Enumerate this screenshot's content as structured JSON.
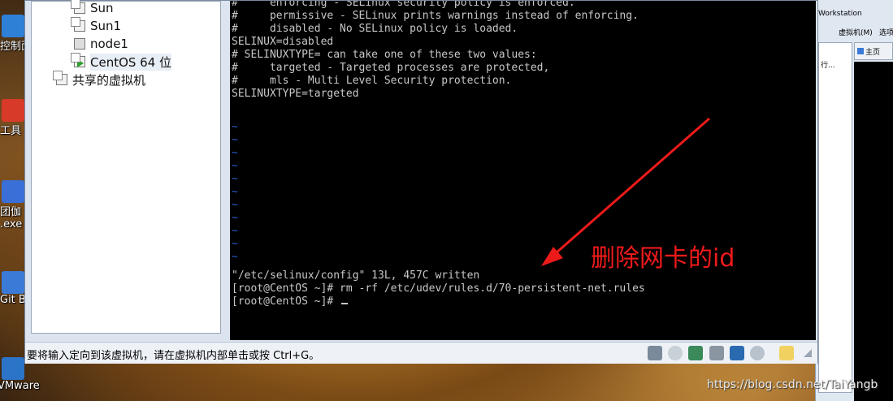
{
  "desktop": {
    "icons": [
      {
        "label": "控制面",
        "color": "#2e7fd6"
      },
      {
        "label": "工具",
        "color": "#d83a2a"
      },
      {
        "label": "团伽",
        "color": "#3a6fd8"
      },
      {
        "label": ".exe",
        "color": ""
      },
      {
        "label": "Git B",
        "color": "#3b7ad6"
      },
      {
        "label": "VMware",
        "color": "#2c74c8"
      }
    ]
  },
  "library": {
    "items": [
      {
        "label": "Sun"
      },
      {
        "label": "Sun1"
      },
      {
        "label": "node1"
      },
      {
        "label": "CentOS 64 位"
      },
      {
        "label": "共享的虚拟机"
      }
    ]
  },
  "console": {
    "lines": [
      "#     enforcing - SELinux security policy is enforced.",
      "#     permissive - SELinux prints warnings instead of enforcing.",
      "#     disabled - No SELinux policy is loaded.",
      "SELINUX=disabled",
      "# SELINUXTYPE= can take one of these two values:",
      "#     targeted - Targeted processes are protected,",
      "#     mls - Multi Level Security protection.",
      "SELINUXTYPE=targeted"
    ],
    "tilde": "~",
    "written": "\"/etc/selinux/config\" 13L, 457C written",
    "command": "[root@CentOS ~]# rm -rf /etc/udev/rules.d/70-persistent-net.rules",
    "prompt": "[root@CentOS ~]# "
  },
  "annotation": {
    "text": "删除网卡的id",
    "color": "#ee1a1a"
  },
  "statusbar": {
    "text": "要将输入定向到该虚拟机，请在虚拟机内部单击或按 Ctrl+G。"
  },
  "background_window": {
    "title": "Workstation",
    "menu_vm": "虚拟机(M)",
    "menu_options": "选项",
    "home_tab": "主页",
    "panel_label": "行..."
  },
  "watermark": "https://blog.csdn.net/TaiYangb"
}
